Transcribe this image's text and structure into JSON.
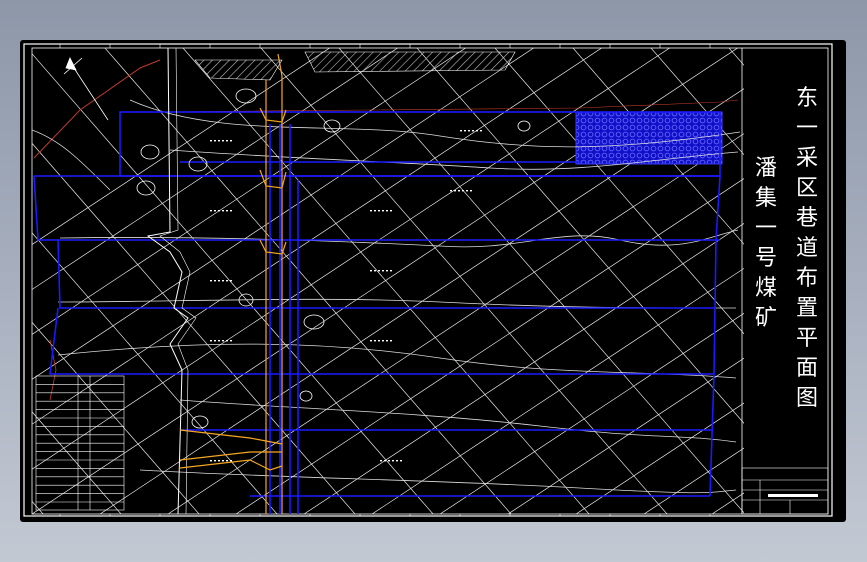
{
  "drawing": {
    "title": "东一采区巷道布置平面图",
    "mine_name": "潘集一号煤矿"
  },
  "colors": {
    "background": "#000000",
    "roadway": "#1a1aff",
    "contour": "#ffffff",
    "coal_pillar_boundary": "#c0392b",
    "shaft_track": "#f5a623",
    "hatch_zone": "#1a1aff"
  }
}
